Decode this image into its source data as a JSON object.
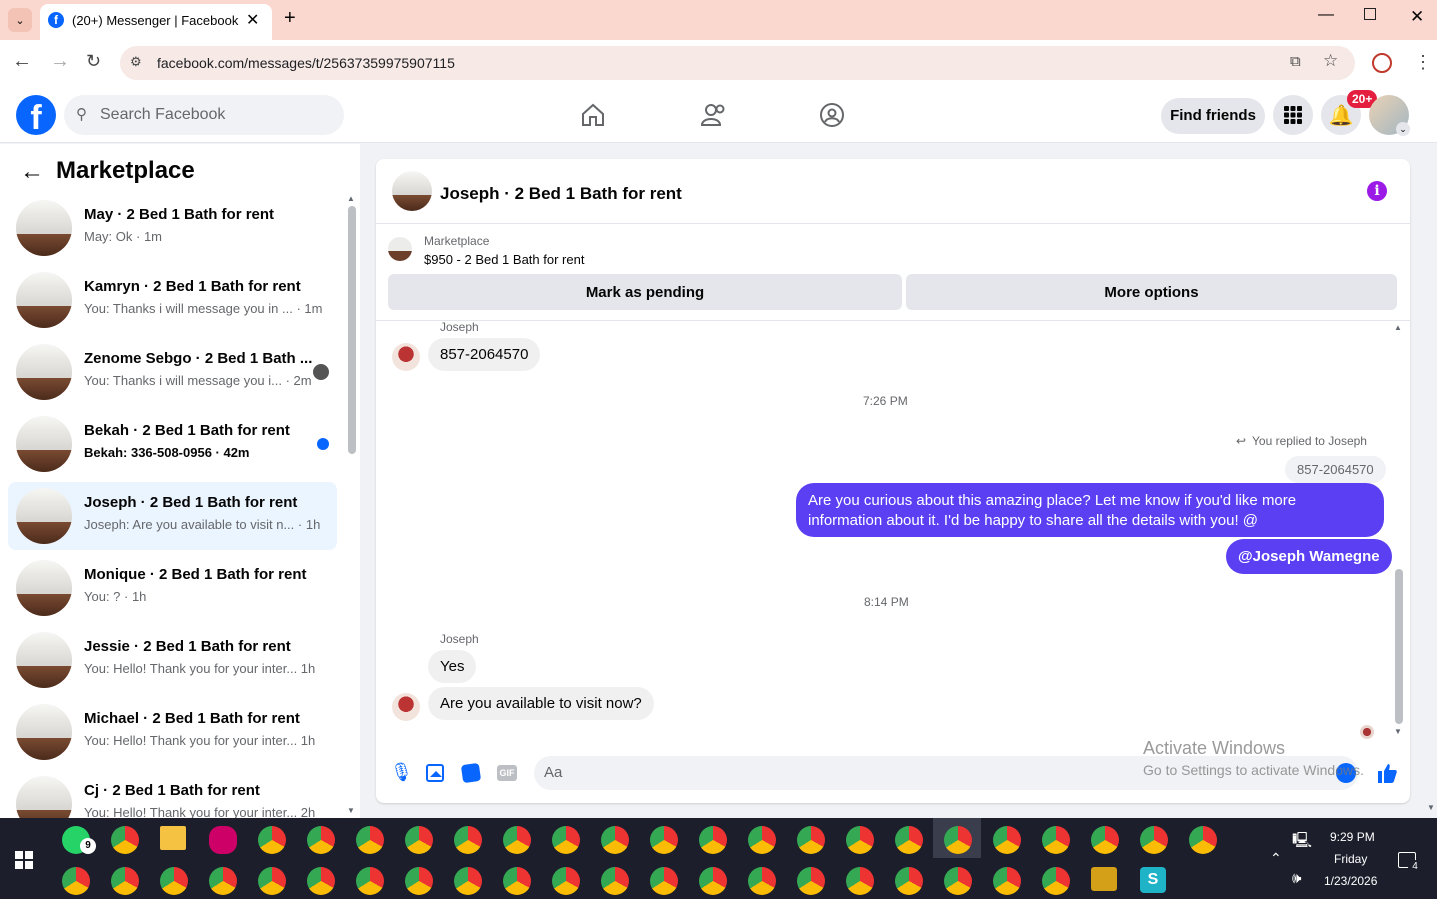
{
  "browser": {
    "tab_title": "(20+) Messenger | Facebook",
    "url": "facebook.com/messages/t/25637359975907115"
  },
  "fb": {
    "search_placeholder": "Search Facebook",
    "find_friends": "Find friends",
    "notif_badge": "20+"
  },
  "left": {
    "title": "Marketplace",
    "conversations": [
      {
        "title": "May · 2 Bed 1 Bath for rent",
        "preview": "May: Ok · 1m"
      },
      {
        "title": "Kamryn · 2 Bed 1 Bath for rent",
        "preview": "You: Thanks i will message you in ... · 1m"
      },
      {
        "title": "Zenome Sebgo · 2 Bed 1 Bath ...",
        "preview": "You: Thanks i will message you i... · 2m"
      },
      {
        "title": "Bekah · 2 Bed 1 Bath for rent",
        "preview": "Bekah: 336-508-0956 · 42m"
      },
      {
        "title": "Joseph · 2 Bed 1 Bath for rent",
        "preview": "Joseph: Are you available to visit n... · 1h"
      },
      {
        "title": "Monique · 2 Bed 1 Bath for rent",
        "preview": "You: ? · 1h"
      },
      {
        "title": "Jessie · 2 Bed 1 Bath for rent",
        "preview": "You: Hello! Thank you for your inter... 1h"
      },
      {
        "title": "Michael · 2 Bed 1 Bath for rent",
        "preview": "You: Hello! Thank you for your inter... 1h"
      },
      {
        "title": "Cj · 2 Bed 1 Bath for rent",
        "preview": "You: Hello! Thank you for your inter... 2h"
      }
    ]
  },
  "chat": {
    "title": "Joseph · 2 Bed 1 Bath for rent",
    "listing_label": "Marketplace",
    "listing": "$950 - 2 Bed 1 Bath for rent",
    "mark_pending": "Mark as pending",
    "more_options": "More options",
    "sender1": "Joseph",
    "msg1": "857-2064570",
    "time1": "7:26 PM",
    "replied": "You replied to Joseph",
    "quoted": "857-2064570",
    "my_msg_line1": "Are you curious about this amazing place? Let me know if you'd like more",
    "my_msg_line2": "information about it. I'd be happy to share all the details with you! @",
    "mention": "@Joseph Wamegne",
    "time2": "8:14 PM",
    "sender2": "Joseph",
    "msg2": "Yes",
    "msg3": "Are you available to visit now?",
    "input_placeholder": "Aa"
  },
  "watermark": {
    "line1": "Activate Windows",
    "line2": "Go to Settings to activate Windows."
  },
  "taskbar": {
    "time": "9:29 PM",
    "day": "Friday",
    "date": "1/23/2026",
    "whatsapp_badge": "9",
    "notif_count": "4"
  },
  "colors": {
    "fb_blue": "#0866ff",
    "messenger_purple": "#5b3ff3",
    "unread_dot": "#0866ff"
  }
}
